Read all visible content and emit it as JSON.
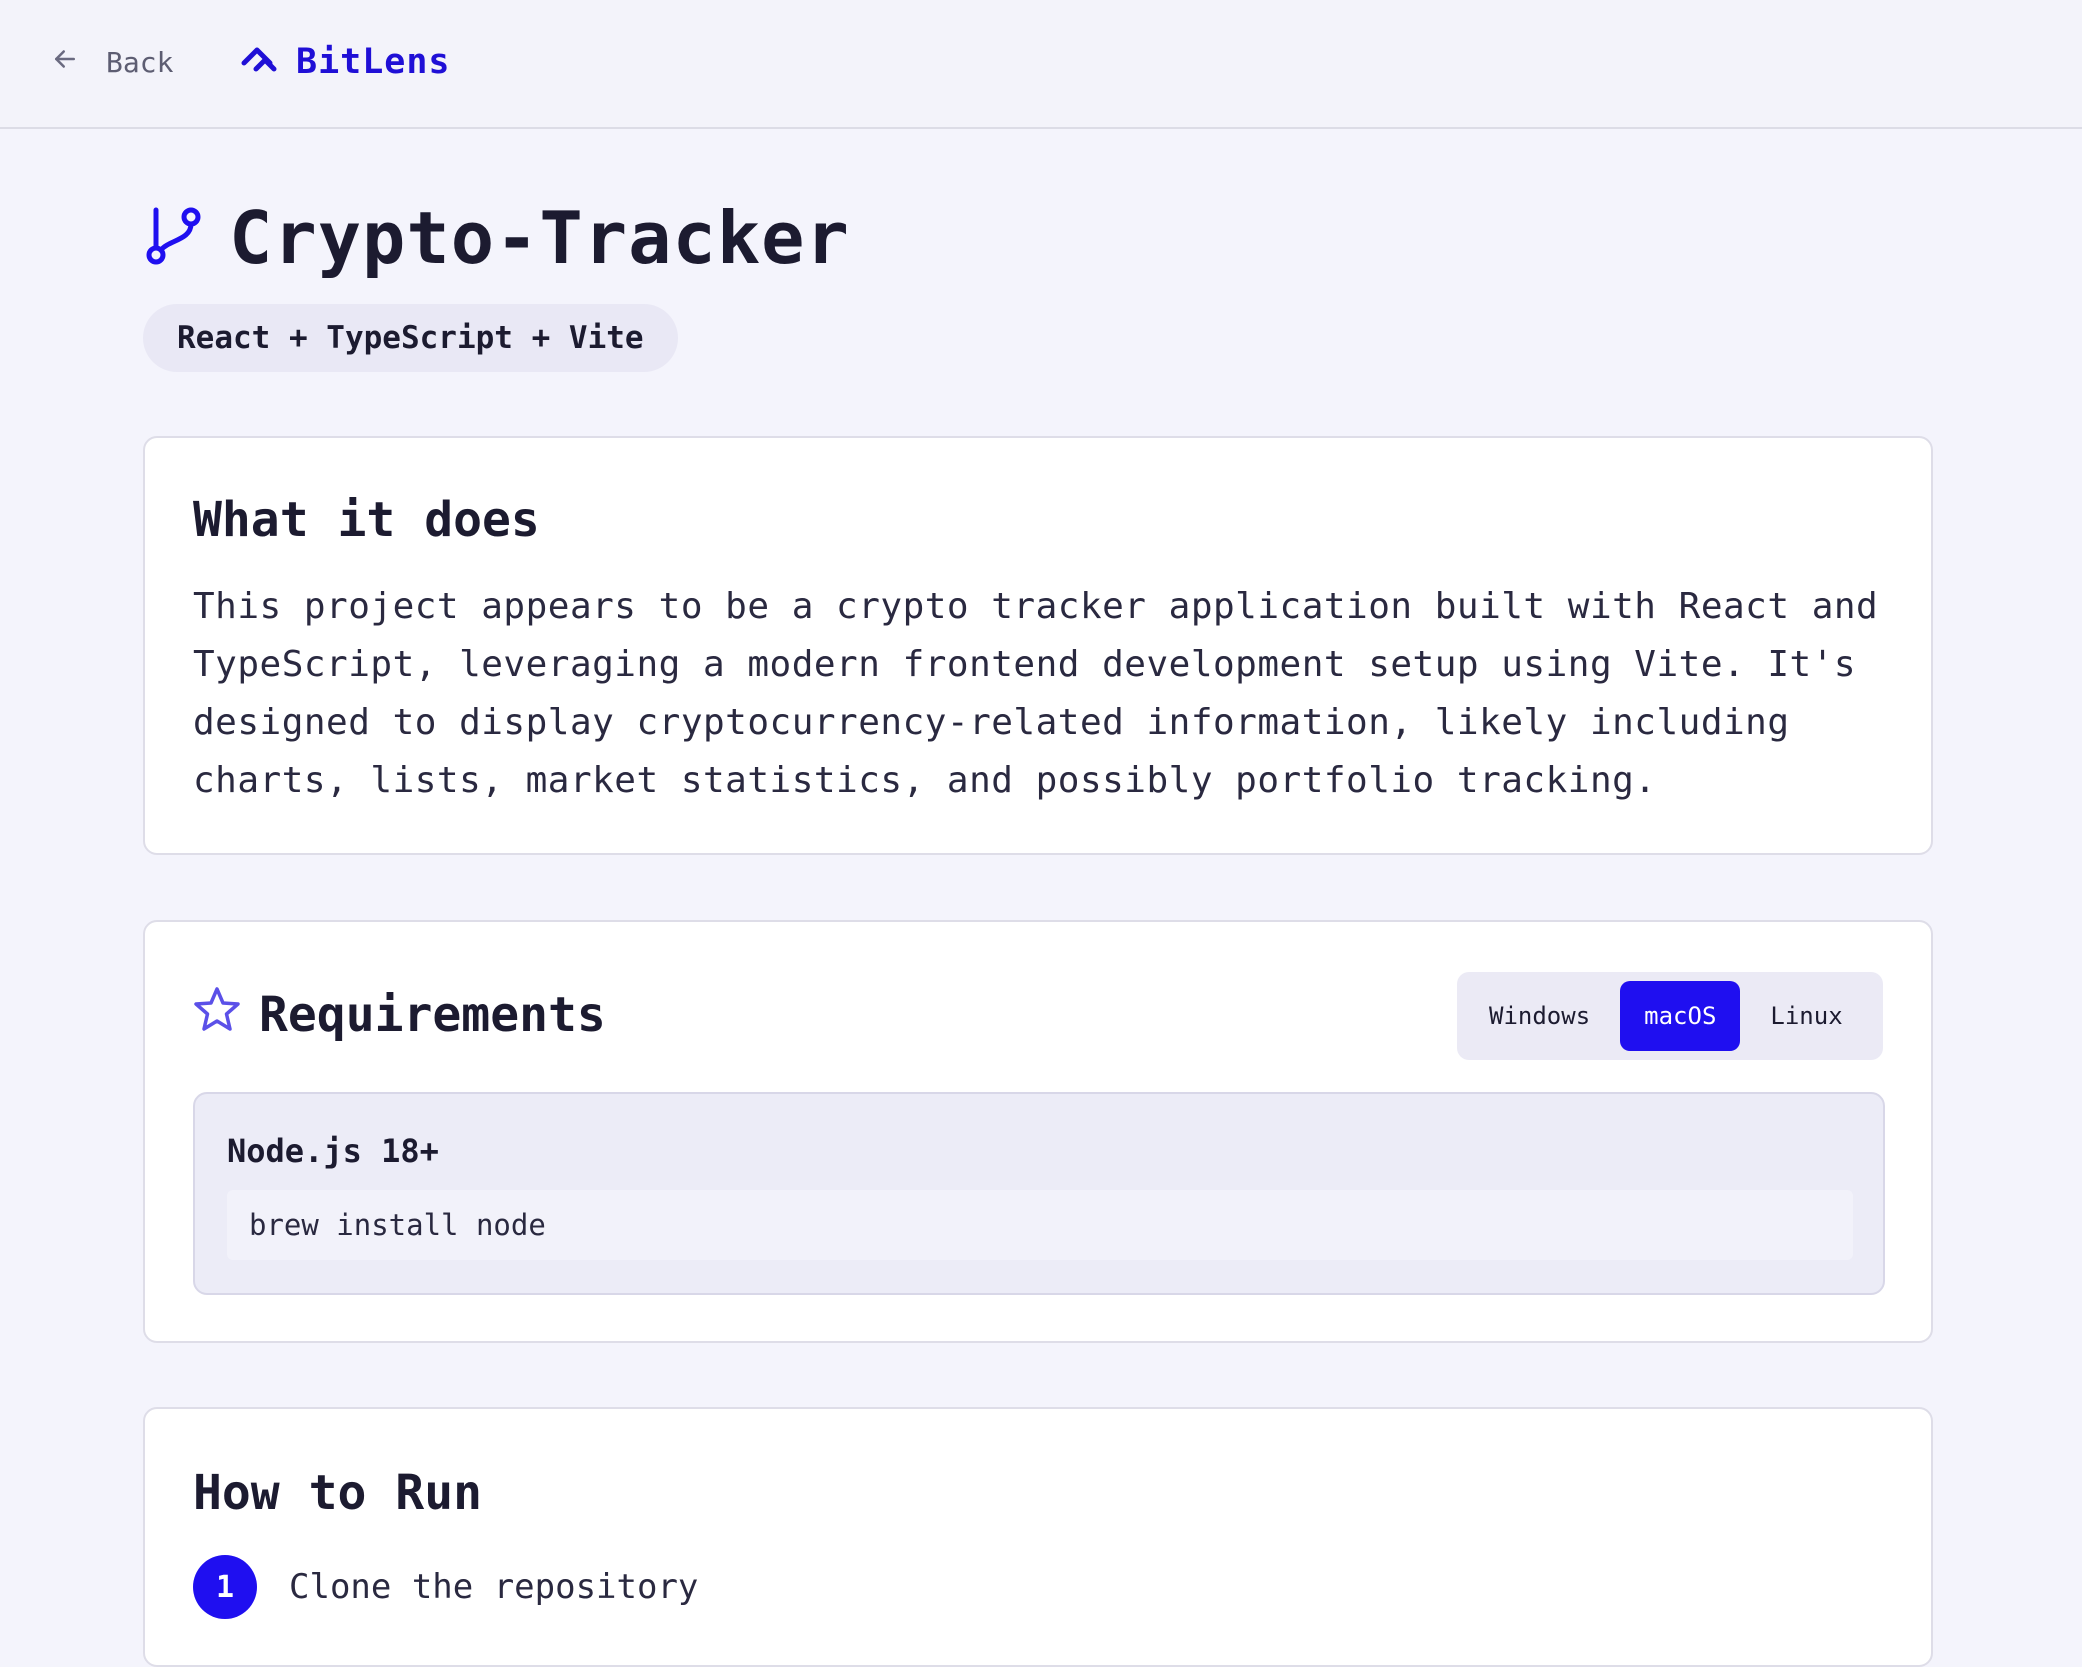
{
  "nav": {
    "back_label": "Back",
    "brand_name": "BitLens",
    "brand_color": "#1f0fd6"
  },
  "project": {
    "title": "Crypto-Tracker",
    "stack": "React + TypeScript + Vite",
    "icon": "git-branch-icon"
  },
  "what_it_does": {
    "heading": "What it does",
    "description": "This project appears to be a crypto tracker application built with React and TypeScript, leveraging a modern frontend development setup using Vite. It's designed to display cryptocurrency-related information, likely including charts, lists, market statistics, and possibly portfolio tracking."
  },
  "requirements": {
    "heading": "Requirements",
    "icon": "star-icon",
    "os_tabs": [
      "Windows",
      "macOS",
      "Linux"
    ],
    "selected_os": "macOS",
    "items": [
      {
        "name": "Node.js 18+",
        "command": "brew install node"
      }
    ]
  },
  "how_to_run": {
    "heading": "How to Run",
    "steps": [
      {
        "number": "1",
        "text": "Clone the repository"
      }
    ]
  },
  "colors": {
    "accent": "#1f0ff0",
    "background": "#f4f4fc"
  }
}
